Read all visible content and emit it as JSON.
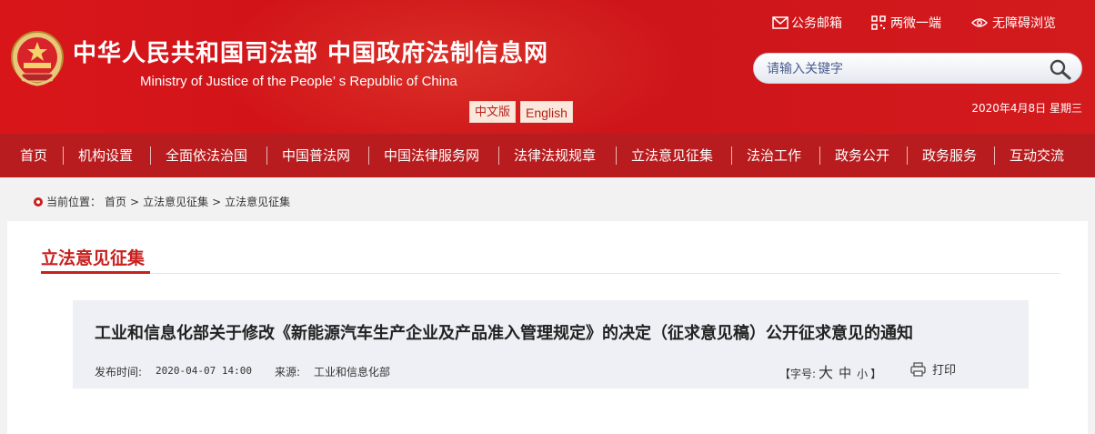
{
  "header": {
    "title": "中华人民共和国司法部  中国政府法制信息网",
    "subtitle": "Ministry of Justice of the People’ s Republic of China",
    "lang_cn": "中文版",
    "lang_en": "English",
    "links": [
      {
        "label": "公务邮箱",
        "icon": "mail-icon"
      },
      {
        "label": "两微一端",
        "icon": "qr-icon"
      },
      {
        "label": "无障碍浏览",
        "icon": "eye-icon"
      }
    ],
    "search_placeholder": "请输入关键字",
    "date": "2020年4月8日  星期三",
    "colors": {
      "primary": "#d21a1d",
      "nav": "#b81c1e"
    }
  },
  "nav": [
    "首页",
    "机构设置",
    "全面依法治国",
    "中国普法网",
    "中国法律服务网",
    "法律法规规章",
    "立法意见征集",
    "法治工作",
    "政务公开",
    "政务服务",
    "互动交流"
  ],
  "breadcrumb": {
    "prefix": "当前位置：",
    "items": [
      "首页",
      ">",
      "立法意见征集",
      ">",
      "立法意见征集"
    ]
  },
  "section": {
    "title": "立法意见征集"
  },
  "article": {
    "title": "工业和信息化部关于修改《新能源汽车生产企业及产品准入管理规定》的决定（征求意见稿）公开征求意见的通知",
    "time_label": "发布时间:",
    "time_value": "2020-04-07 14:00",
    "source_label": "来源:",
    "source_value": "工业和信息化部",
    "fontsize_label": "【字号:",
    "fontsize_large": "大",
    "fontsize_medium": "中",
    "fontsize_small": "小",
    "fontsize_close": "】",
    "print_label": "打印"
  }
}
